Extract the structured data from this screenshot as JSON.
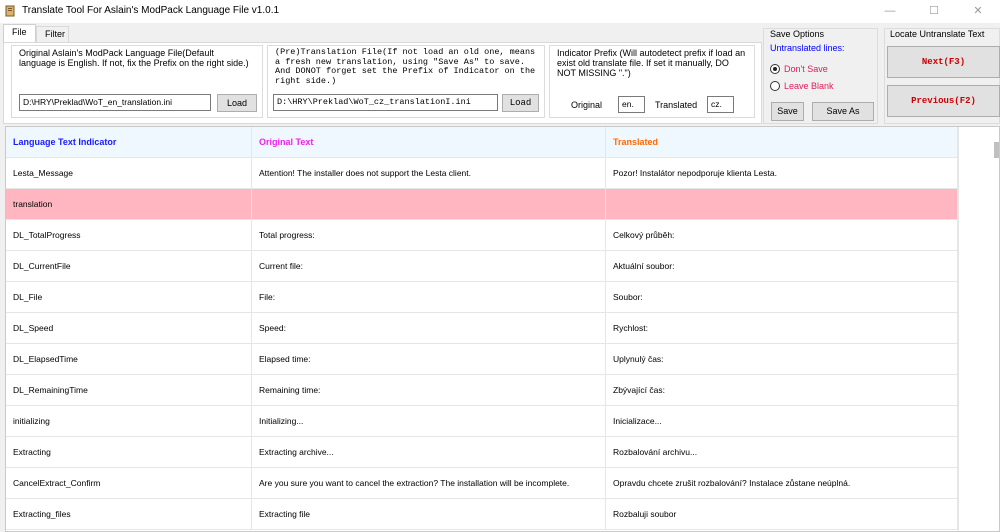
{
  "window": {
    "title": "Translate Tool For Aslain's ModPack Language File v1.0.1",
    "minimize": "—",
    "maximize": "☐",
    "close": "✕"
  },
  "tabs": [
    {
      "label": "File",
      "active": true
    },
    {
      "label": "Filter",
      "active": false
    }
  ],
  "original_group": {
    "title": "Original Aslain's ModPack Language File(Default language is English. If not, fix the Prefix on the right side.)",
    "path": "D:\\HRY\\Preklad\\WoT_en_translation.ini",
    "load_label": "Load"
  },
  "pretranslation_group": {
    "title": "(Pre)Translation File(If not load an old one, means a fresh new translation, using \"Save As\" to save. And DONOT forget set the Prefix of Indicator on the right side.)",
    "path": "D:\\HRY\\Preklad\\WoT_cz_translationI.ini",
    "load_label": "Load"
  },
  "prefix_group": {
    "title": "Indicator Prefix (Will autodetect prefix if load an exist old translate file. If set it manually, DO NOT MISSING \".\")",
    "original_label": "Original",
    "original_value": "en.",
    "translated_label": "Translated",
    "translated_value": "cz."
  },
  "save_options": {
    "title": "Save Options",
    "untranslated_label": "Untranslated lines:",
    "dont_save": "Don't Save",
    "leave_blank": "Leave Blank",
    "selected": "dont_save",
    "save_label": "Save",
    "save_as_label": "Save As",
    "accent_color": "#0000ff",
    "option_color": "#e01e5a"
  },
  "locate": {
    "title": "Locate Untranslate Text",
    "next_label": "Next(F3)",
    "previous_label": "Previous(F2)"
  },
  "grid": {
    "headers": {
      "indicator": "Language Text Indicator",
      "original": "Original Text",
      "translated": "Translated"
    },
    "header_colors": {
      "indicator": "#1a1aff",
      "original": "#ee22ee",
      "translated": "#ff6a00"
    },
    "highlight_color": "#ffb6c1",
    "rows": [
      {
        "key": "Lesta_Message",
        "original": "Attention! The installer does not support the Lesta client.",
        "translated": "Pozor! Instalátor nepodporuje klienta Lesta.",
        "highlight": false
      },
      {
        "key": "translation",
        "original": "",
        "translated": "",
        "highlight": true
      },
      {
        "key": "DL_TotalProgress",
        "original": "Total progress:",
        "translated": "Celkový průběh:",
        "highlight": false
      },
      {
        "key": "DL_CurrentFile",
        "original": "Current file:",
        "translated": "Aktuální soubor:",
        "highlight": false
      },
      {
        "key": "DL_File",
        "original": "File:",
        "translated": "Soubor:",
        "highlight": false
      },
      {
        "key": "DL_Speed",
        "original": "Speed:",
        "translated": "Rychlost:",
        "highlight": false
      },
      {
        "key": "DL_ElapsedTime",
        "original": "Elapsed time:",
        "translated": "Uplynulý čas:",
        "highlight": false
      },
      {
        "key": "DL_RemainingTime",
        "original": "Remaining time:",
        "translated": "Zbývající čas:",
        "highlight": false
      },
      {
        "key": "initializing",
        "original": "Initializing...",
        "translated": "Inicializace...",
        "highlight": false
      },
      {
        "key": "Extracting",
        "original": "Extracting archive...",
        "translated": "Rozbalování archivu...",
        "highlight": false
      },
      {
        "key": "CancelExtract_Confirm",
        "original": "Are you sure you want to cancel the extraction? The installation will be incomplete.",
        "translated": "Opravdu chcete zrušit rozbalování? Instalace zůstane neúplná.",
        "highlight": false
      },
      {
        "key": "Extracting_files",
        "original": "Extracting file",
        "translated": "Rozbaluji soubor",
        "highlight": false
      }
    ]
  }
}
